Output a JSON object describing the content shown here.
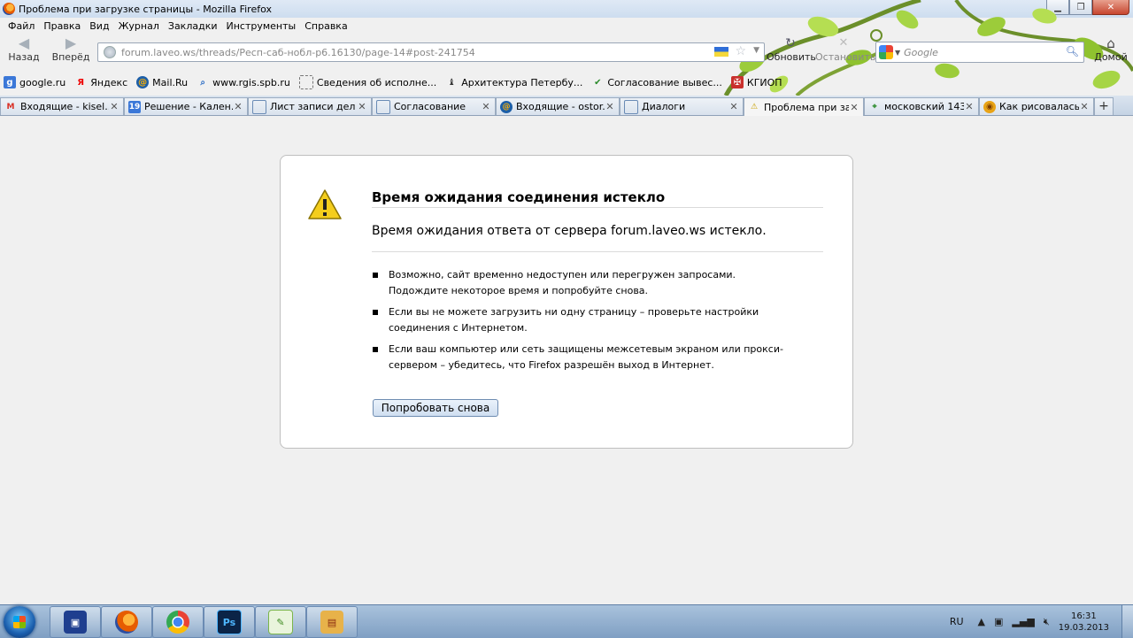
{
  "window": {
    "title": "Проблема при загрузке страницы - Mozilla Firefox"
  },
  "menu": [
    "Файл",
    "Правка",
    "Вид",
    "Журнал",
    "Закладки",
    "Инструменты",
    "Справка"
  ],
  "nav": {
    "back_label": "Назад",
    "forward_label": "Вперёд",
    "url": "forum.laveo.ws/threads/Респ-саб-нобл-р6.16130/page-14#post-241754",
    "reload_label": "Обновить",
    "stop_label": "Остановить",
    "search_placeholder": "Google",
    "home_label": "Домой"
  },
  "bookmarks": [
    {
      "label": "google.ru",
      "icon": "google-icon"
    },
    {
      "label": "Яндекс",
      "icon": "yandex-icon"
    },
    {
      "label": "Mail.Ru",
      "icon": "mailru-icon"
    },
    {
      "label": "www.rgis.spb.ru",
      "icon": "search-icon"
    },
    {
      "label": "Сведения об исполне...",
      "icon": "page-icon"
    },
    {
      "label": "Архитектура Петербу...",
      "icon": "chess-icon"
    },
    {
      "label": "Согласование вывес...",
      "icon": "check-icon"
    },
    {
      "label": "КГИОП",
      "icon": "kgiop-icon"
    }
  ],
  "tabs": [
    {
      "label": "Входящие - kisel...",
      "icon": "gmail-icon"
    },
    {
      "label": "Решение - Кален...",
      "icon": "calendar-icon"
    },
    {
      "label": "Лист записи дел ...",
      "icon": "page-icon"
    },
    {
      "label": "Согласование",
      "icon": "page-icon"
    },
    {
      "label": "Входящие - ostor...",
      "icon": "mailru-icon"
    },
    {
      "label": "Диалоги",
      "icon": "page-icon"
    },
    {
      "label": "Проблема при за...",
      "icon": "warning-icon"
    },
    {
      "label": "московский 143 - ...",
      "icon": "map-icon"
    },
    {
      "label": "Как рисовалась ...",
      "icon": "globe-icon"
    }
  ],
  "error": {
    "title": "Время ожидания соединения истекло",
    "subtitle": "Время ожидания ответа от сервера forum.laveo.ws истекло.",
    "items": [
      "Возможно, сайт временно недоступен или перегружен запросами. Подождите некоторое время и попробуйте снова.",
      "Если вы не можете загрузить ни одну страницу – проверьте настройки соединения с Интернетом.",
      "Если ваш компьютер или сеть защищены межсетевым экраном или прокси-сервером – убедитесь, что Firefox разрешён выход в Интернет."
    ],
    "retry_label": "Попробовать снова"
  },
  "taskbar": {
    "apps": [
      {
        "icon": "floppy-icon",
        "text": ""
      },
      {
        "icon": "firefox-icon",
        "text": ""
      },
      {
        "icon": "chrome-icon",
        "text": ""
      },
      {
        "icon": "photoshop-icon",
        "text": "Ps"
      },
      {
        "icon": "coreldraw-icon",
        "text": ""
      },
      {
        "icon": "archive-icon",
        "text": ""
      }
    ],
    "lang": "RU",
    "time": "16:31",
    "date": "19.03.2013"
  },
  "colors": {
    "accent": "#1b5fae",
    "warning": "#f2c200",
    "page_bg": "#f0f0f0"
  }
}
